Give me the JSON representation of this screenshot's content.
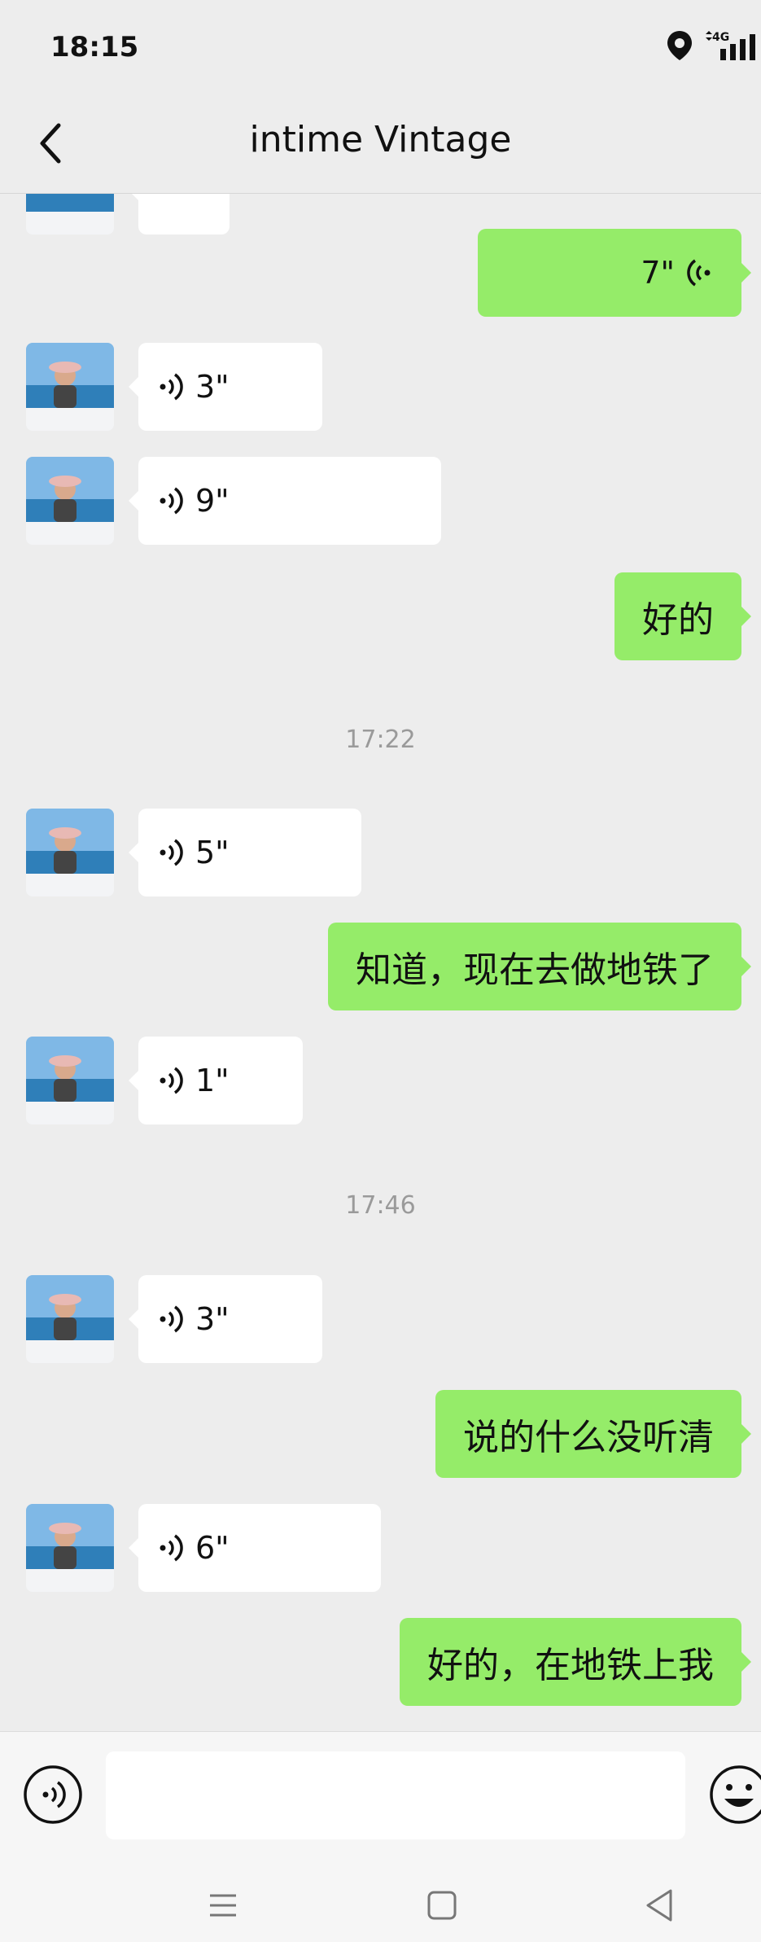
{
  "status": {
    "time": "18:15",
    "network": "4G"
  },
  "header": {
    "title": "intime Vintage"
  },
  "messages": [
    {
      "type": "voice-in",
      "duration": "3\""
    },
    {
      "type": "voice-in",
      "duration": "9\""
    },
    {
      "type": "text-out",
      "text": "好的"
    },
    {
      "type": "voice-in",
      "duration": "5\""
    },
    {
      "type": "text-out",
      "text": "知道，现在去做地铁了"
    },
    {
      "type": "voice-in",
      "duration": "1\""
    },
    {
      "type": "voice-in",
      "duration": "3\""
    },
    {
      "type": "text-out",
      "text": "说的什么没听清"
    },
    {
      "type": "voice-in",
      "duration": "6\""
    },
    {
      "type": "text-out",
      "text": "好的，在地铁上我"
    }
  ],
  "voice_out_top": {
    "duration": "7\""
  },
  "timestamps": [
    "17:22",
    "17:46"
  ],
  "input": {
    "placeholder": ""
  },
  "colors": {
    "background": "#ededed",
    "bubble_out": "#95ec69",
    "bubble_in": "#ffffff",
    "timestamp": "#9a9a9a"
  },
  "icons": [
    "location-icon",
    "signal-icon",
    "back-arrow-icon",
    "voice-wave-icon",
    "voice-toggle-icon",
    "emoji-icon",
    "menu-key-icon",
    "home-key-icon",
    "back-key-icon"
  ]
}
